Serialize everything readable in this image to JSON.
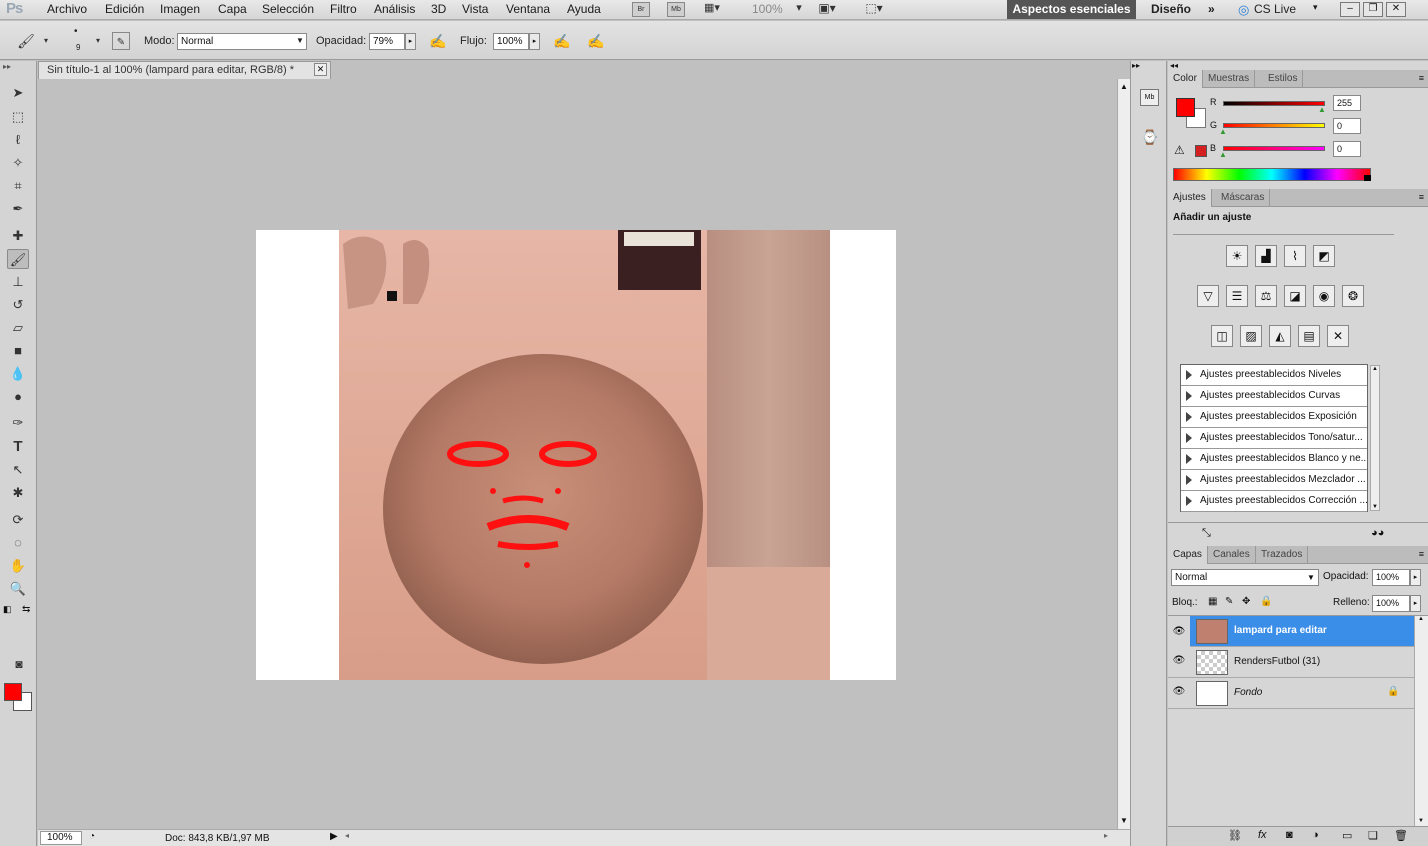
{
  "app": {
    "logo": "Ps"
  },
  "menu": [
    "Archivo",
    "Edición",
    "Imagen",
    "Capa",
    "Selección",
    "Filtro",
    "Análisis",
    "3D",
    "Vista",
    "Ventana",
    "Ayuda"
  ],
  "menubar": {
    "bridge": "Br",
    "minibridge": "Mb",
    "zoom": "100%",
    "workspace_active": "Aspectos esenciales",
    "workspace_other": "Diseño",
    "cslive": "CS Live"
  },
  "options": {
    "brush_size": "9",
    "mode_label": "Modo:",
    "mode_value": "Normal",
    "opacity_label": "Opacidad:",
    "opacity_value": "79%",
    "flow_label": "Flujo:",
    "flow_value": "100%"
  },
  "document": {
    "tab_title": "Sin título-1 al 100% (lampard para editar, RGB/8) *",
    "status_zoom": "100%",
    "status_doc": "Doc: 843,8 KB/1,97 MB"
  },
  "color_panel": {
    "tabs": [
      "Color",
      "Muestras",
      "Estilos"
    ],
    "r_label": "R",
    "g_label": "G",
    "b_label": "B",
    "r": "255",
    "g": "0",
    "b": "0",
    "fg_color": "#ff0000",
    "bg_color": "#ffffff"
  },
  "adjust_panel": {
    "tabs": [
      "Ajustes",
      "Máscaras"
    ],
    "title": "Añadir un ajuste",
    "presets": [
      "Ajustes preestablecidos Niveles",
      "Ajustes preestablecidos Curvas",
      "Ajustes preestablecidos Exposición",
      "Ajustes preestablecidos Tono/satur...",
      "Ajustes preestablecidos Blanco y ne...",
      "Ajustes preestablecidos Mezclador ...",
      "Ajustes preestablecidos Corrección ..."
    ]
  },
  "layers_panel": {
    "tabs": [
      "Capas",
      "Canales",
      "Trazados"
    ],
    "blend": "Normal",
    "opacity_label": "Opacidad:",
    "opacity": "100%",
    "lock_label": "Bloq.:",
    "fill_label": "Relleno:",
    "fill": "100%",
    "layers": [
      "lampard para editar",
      "RendersFutbol (31)",
      "Fondo"
    ]
  },
  "accent": "#3b8ee8"
}
